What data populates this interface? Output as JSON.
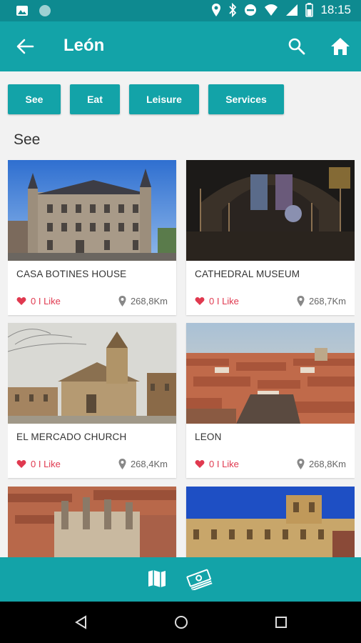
{
  "status_bar": {
    "time": "18:15"
  },
  "app_bar": {
    "title": "León"
  },
  "filters": [
    {
      "label": "See"
    },
    {
      "label": "Eat"
    },
    {
      "label": "Leisure"
    },
    {
      "label": "Services"
    }
  ],
  "section": {
    "title": "See"
  },
  "cards": [
    {
      "name": "CASA BOTINES HOUSE",
      "likes": "0 I Like",
      "distance": "268,8Km"
    },
    {
      "name": "CATHEDRAL MUSEUM",
      "likes": "0 I Like",
      "distance": "268,7Km"
    },
    {
      "name": "EL MERCADO CHURCH",
      "likes": "0 I Like",
      "distance": "268,4Km"
    },
    {
      "name": "LEON",
      "likes": "0 I Like",
      "distance": "268,8Km"
    },
    {
      "name": "",
      "likes": "",
      "distance": ""
    },
    {
      "name": "",
      "likes": "",
      "distance": ""
    }
  ],
  "colors": {
    "primary": "#13a3a8",
    "status_bar": "#0e8a90",
    "like": "#e0394f"
  }
}
